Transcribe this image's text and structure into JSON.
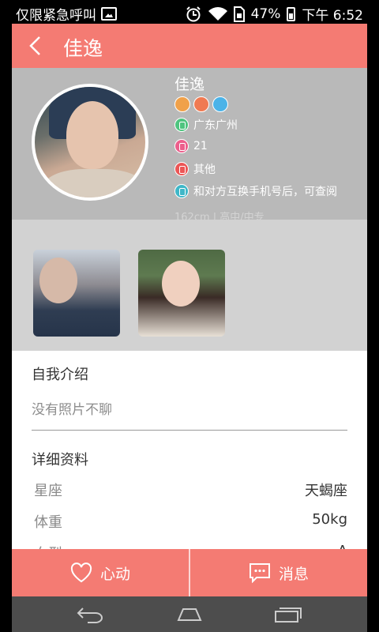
{
  "statusbar": {
    "left_text": "仅限紧急呼叫",
    "battery": "47%",
    "time": "下午 6:52"
  },
  "titlebar": {
    "title": "佳逸"
  },
  "profile": {
    "name": "佳逸",
    "location": "广东广州",
    "age": "21",
    "occupation": "其他",
    "phone_note": "和对方互换手机号后，可查阅",
    "height_edu": "162cm | 高中/中专"
  },
  "intro": {
    "title": "自我介绍",
    "text": "没有照片不聊"
  },
  "details": {
    "title": "详细资料",
    "rows": [
      {
        "label": "星座",
        "value": "天蝎座"
      },
      {
        "label": "体重",
        "value": "50kg"
      },
      {
        "label": "血型",
        "value": "A"
      }
    ]
  },
  "actions": {
    "like_label": "心动",
    "message_label": "消息"
  },
  "colors": {
    "accent": "#f47b73",
    "profile_bg": "#b9b9b9",
    "photos_bg": "#d2d2d2"
  },
  "icons": [
    "back-arrow-icon",
    "heart-icon",
    "message-icon",
    "back-nav-icon",
    "home-nav-icon",
    "recents-nav-icon"
  ]
}
